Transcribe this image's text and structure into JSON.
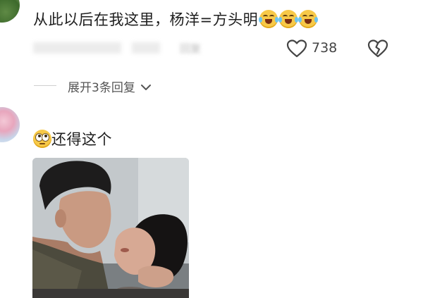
{
  "comment_1": {
    "text": "从此以后在我这里，杨洋=方头明",
    "emojis": [
      "laugh-cry-emoji",
      "laugh-cry-emoji",
      "laugh-cry-emoji"
    ],
    "meta_blurred": "            ",
    "reply_label": "回复",
    "like_count": "738"
  },
  "replies": {
    "expand_label": "展开3条回复"
  },
  "comment_2": {
    "emoji": "eye-roll-emoji",
    "text": "还得这个"
  },
  "colors": {
    "text": "#1e1e1e",
    "meta": "#444444",
    "muted": "#999999"
  }
}
